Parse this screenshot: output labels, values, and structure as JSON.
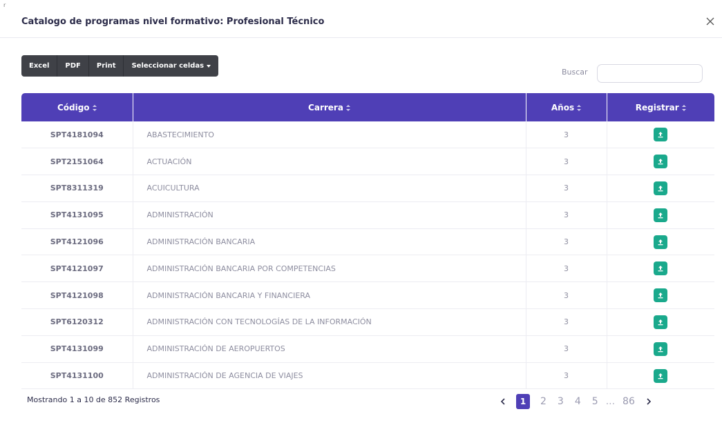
{
  "corner_mark": "r",
  "modal": {
    "title": "Catalogo de programas nivel formativo: Profesional Técnico"
  },
  "toolbar": {
    "excel_label": "Excel",
    "pdf_label": "PDF",
    "print_label": "Print",
    "select_cells_label": "Seleccionar celdas"
  },
  "search": {
    "label": "Buscar",
    "value": "",
    "placeholder": ""
  },
  "table": {
    "columns": [
      "Código",
      "Carrera",
      "Años",
      "Registrar"
    ],
    "rows": [
      {
        "code": "SPT4181094",
        "career": "ABASTECIMIENTO",
        "years": "3"
      },
      {
        "code": "SPT2151064",
        "career": "ACTUACIÓN",
        "years": "3"
      },
      {
        "code": "SPT8311319",
        "career": "ACUICULTURA",
        "years": "3"
      },
      {
        "code": "SPT4131095",
        "career": "ADMINISTRACIÓN",
        "years": "3"
      },
      {
        "code": "SPT4121096",
        "career": "ADMINISTRACIÓN BANCARIA",
        "years": "3"
      },
      {
        "code": "SPT4121097",
        "career": "ADMINISTRACIÓN BANCARIA POR COMPETENCIAS",
        "years": "3"
      },
      {
        "code": "SPT4121098",
        "career": "ADMINISTRACIÓN BANCARIA Y FINANCIERA",
        "years": "3"
      },
      {
        "code": "SPT6120312",
        "career": "ADMINISTRACIÓN CON TECNOLOGÍAS DE LA INFORMACIÓN",
        "years": "3"
      },
      {
        "code": "SPT4131099",
        "career": "ADMINISTRACIÓN DE AEROPUERTOS",
        "years": "3"
      },
      {
        "code": "SPT4131100",
        "career": "ADMINISTRACIÓN DE AGENCIA DE VIAJES",
        "years": "3"
      }
    ],
    "register_icon": "upload-icon"
  },
  "footer": {
    "info": "Mostrando 1 a 10 de 852 Registros"
  },
  "pagination": {
    "pages": [
      "1",
      "2",
      "3",
      "4",
      "5"
    ],
    "current": "1",
    "ellipsis": "...",
    "last": "86"
  },
  "colors": {
    "header_bg": "#4f3fb6",
    "upload_button": "#1aa98c",
    "toolbar_bg": "#3f4147"
  }
}
